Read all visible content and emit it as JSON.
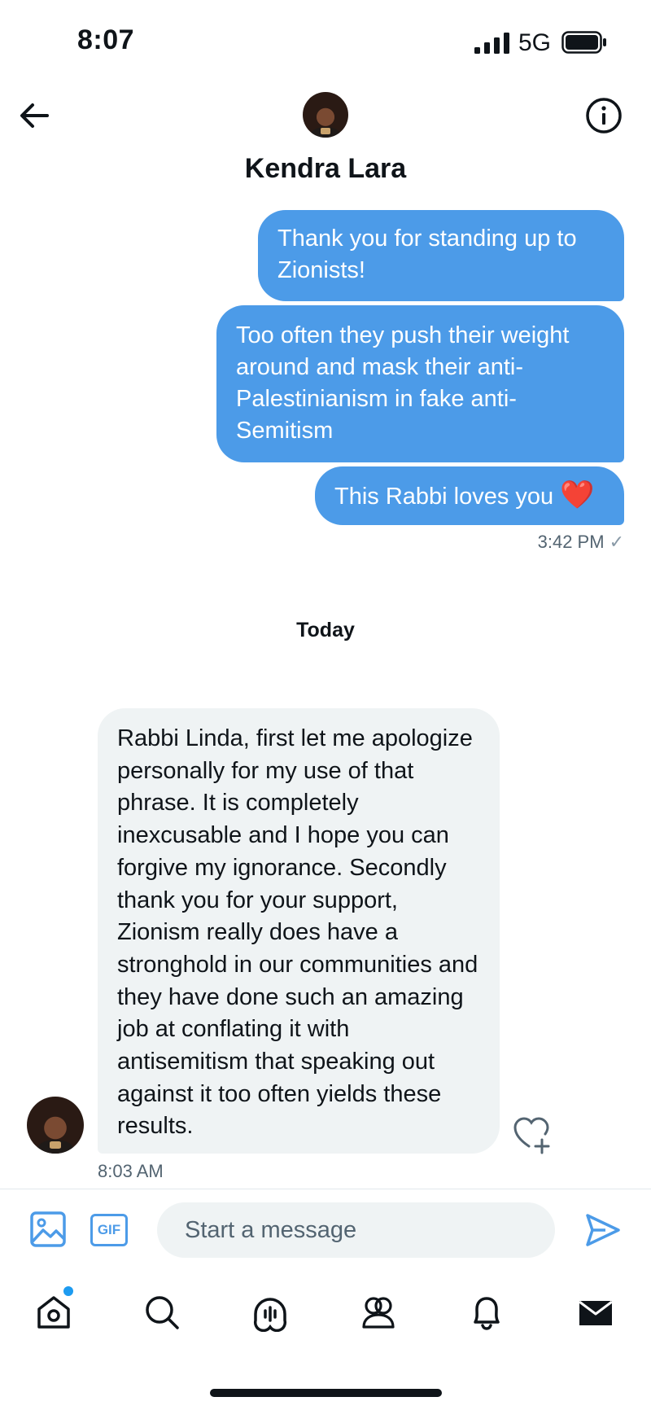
{
  "status_bar": {
    "time": "8:07",
    "network": "5G"
  },
  "header": {
    "contact_name": "Kendra Lara"
  },
  "messages_sent": [
    {
      "text": "Thank you for standing up to Zionists!"
    },
    {
      "text": "Too often they push their weight around and mask their anti-Palestinianism in fake anti-Semitism"
    },
    {
      "text": "This Rabbi loves you",
      "emoji": "❤️"
    }
  ],
  "sent_time": "3:42 PM",
  "day_separator": "Today",
  "message_received": {
    "text": "Rabbi Linda, first let me apologize personally for my use of that phrase. It is completely inexcusable and I hope you can forgive my ignorance. Secondly thank you for your support, Zionism really does have a stronghold in our communities and they have done such an amazing job at conflating it with antisemitism that speaking out against it too often yields these results.",
    "time": "8:03 AM"
  },
  "composer": {
    "placeholder": "Start a message",
    "gif_label": "GIF"
  },
  "colors": {
    "accent": "#4c9be8",
    "received_bubble": "#eff3f4",
    "text": "#0f1419",
    "muted": "#536471"
  },
  "icons": [
    "back-arrow-icon",
    "info-icon",
    "image-icon",
    "gif-icon",
    "send-icon",
    "add-reaction-icon",
    "home-icon",
    "search-icon",
    "spaces-icon",
    "communities-icon",
    "bell-icon",
    "mail-icon"
  ]
}
